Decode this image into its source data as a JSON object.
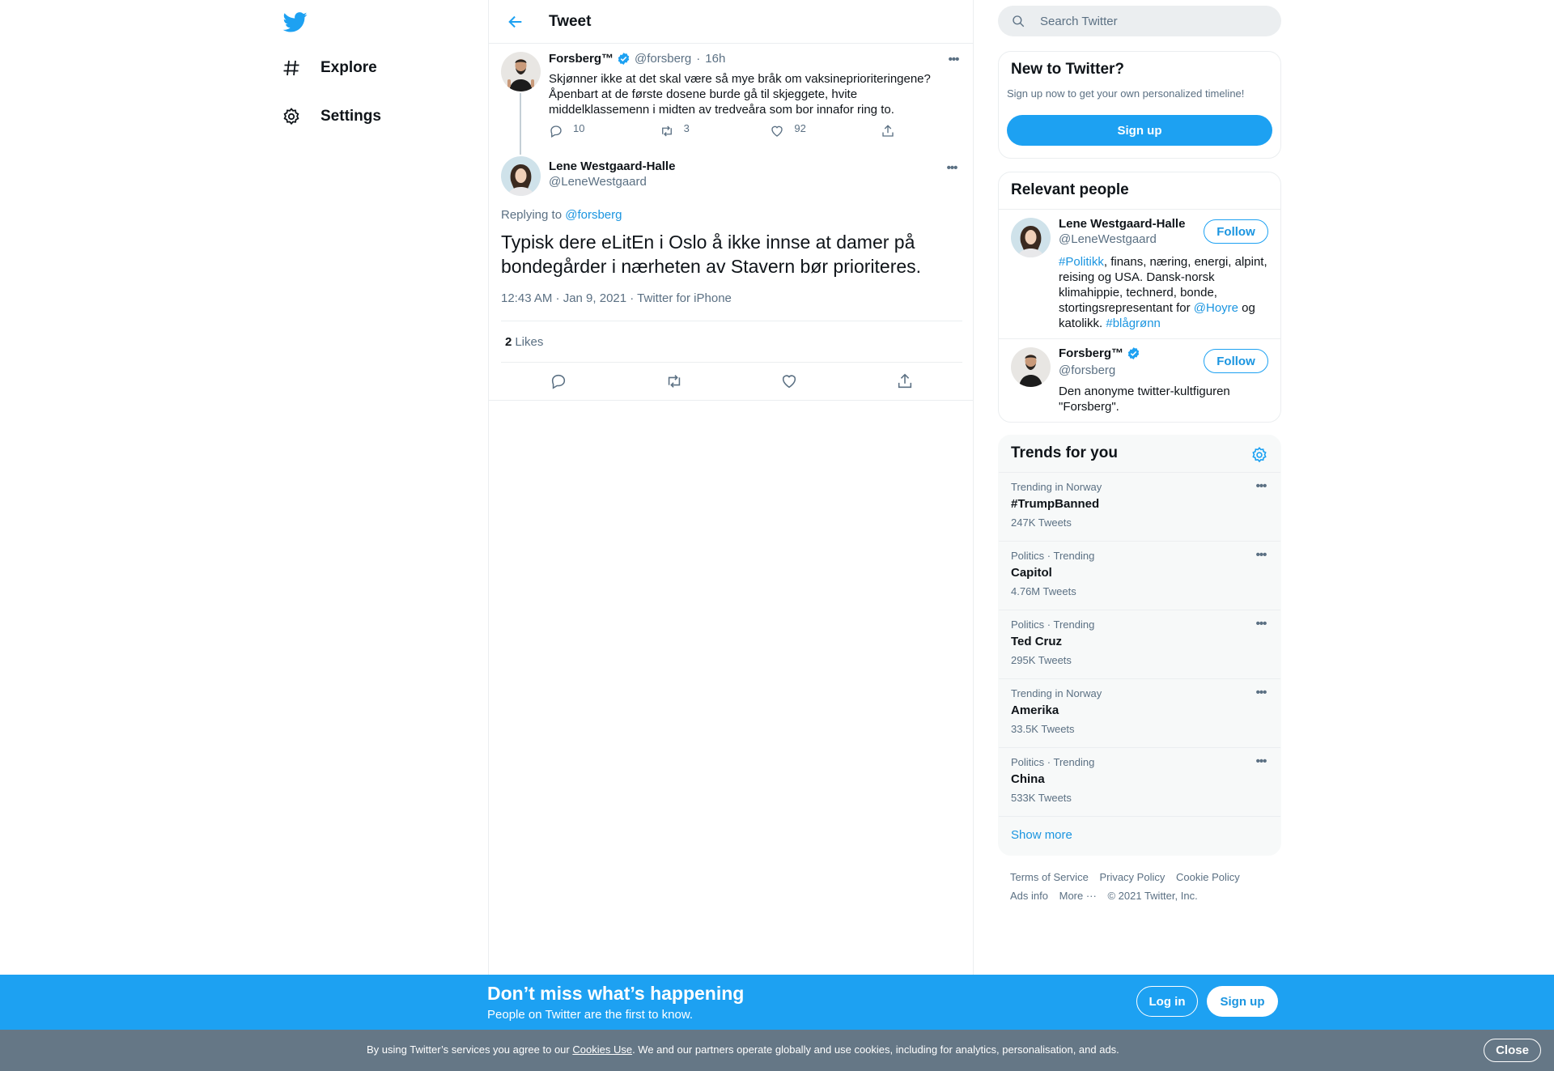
{
  "colors": {
    "accent": "#1da1f2",
    "link": "#1b95e0",
    "muted": "#5b7083",
    "cookie_bg": "#657786"
  },
  "nav": {
    "logo_icon": "twitter-bird-icon",
    "items": [
      {
        "label": "Explore",
        "icon": "hashtag-icon"
      },
      {
        "label": "Settings",
        "icon": "gear-icon"
      }
    ]
  },
  "header": {
    "title": "Tweet",
    "back_icon": "back-arrow-icon"
  },
  "parent_tweet": {
    "name": "Forsberg™",
    "handle": "@forsberg",
    "sep": "·",
    "time": "16h",
    "text": "Skjønner ikke at det skal være så mye bråk om vaksineprioriteringene? Åpenbart at de første dosene burde gå til skjeggete, hvite middelklassemenn i midten av tredveåra som bor innafor ring to.",
    "replies": "10",
    "retweets": "3",
    "likes": "92"
  },
  "focus_tweet": {
    "name": "Lene Westgaard-Halle",
    "handle": "@LeneWestgaard",
    "replying_prefix": "Replying to",
    "replying_to": "@forsberg",
    "text": "Typisk dere eLitEn i Oslo å ikke innse at damer på bondegårder i nærheten av Stavern bør prioriteres.",
    "meta": "12:43 AM · Jan 9, 2021 · Twitter for iPhone",
    "likes_count": "2",
    "likes_label": "Likes"
  },
  "search": {
    "placeholder": "Search Twitter"
  },
  "new_to_twitter": {
    "title": "New to Twitter?",
    "subtitle": "Sign up now to get your own personalized timeline!",
    "button": "Sign up"
  },
  "relevant_people": {
    "title": "Relevant people",
    "people": [
      {
        "name": "Lene Westgaard-Halle",
        "handle": "@LeneWestgaard",
        "follow": "Follow",
        "bio_tag1": "#Politikk",
        "bio_mid": ", finans, næring, energi, alpint, reising og USA. Dansk-norsk klimahippie, technerd, bonde, stortingsrepresentant for ",
        "bio_mention": "@Hoyre",
        "bio_and": " og katolikk. ",
        "bio_tag2": "#blågrønn"
      },
      {
        "name": "Forsberg™",
        "handle": "@forsberg",
        "follow": "Follow",
        "bio": "Den anonyme twitter-kultfiguren \"Forsberg\"."
      }
    ]
  },
  "trends": {
    "title": "Trends for you",
    "items": [
      {
        "context": "Trending in Norway",
        "name": "#TrumpBanned",
        "count": "247K Tweets"
      },
      {
        "context": "Politics · Trending",
        "name": "Capitol",
        "count": "4.76M Tweets"
      },
      {
        "context": "Politics · Trending",
        "name": "Ted Cruz",
        "count": "295K Tweets"
      },
      {
        "context": "Trending in Norway",
        "name": "Amerika",
        "count": "33.5K Tweets"
      },
      {
        "context": "Politics · Trending",
        "name": "China",
        "count": "533K Tweets"
      }
    ],
    "show_more": "Show more"
  },
  "footer": {
    "links": [
      "Terms of Service",
      "Privacy Policy",
      "Cookie Policy",
      "Ads info",
      "More ···"
    ],
    "copyright": "© 2021 Twitter, Inc."
  },
  "bottom_bar": {
    "title": "Don’t miss what’s happening",
    "subtitle": "People on Twitter are the first to know.",
    "login": "Log in",
    "signup": "Sign up"
  },
  "cookie": {
    "prefix": "By using Twitter’s services you agree to our ",
    "link": "Cookies Use",
    "suffix": ". We and our partners operate globally and use cookies, including for analytics, personalisation, and ads.",
    "close": "Close"
  }
}
